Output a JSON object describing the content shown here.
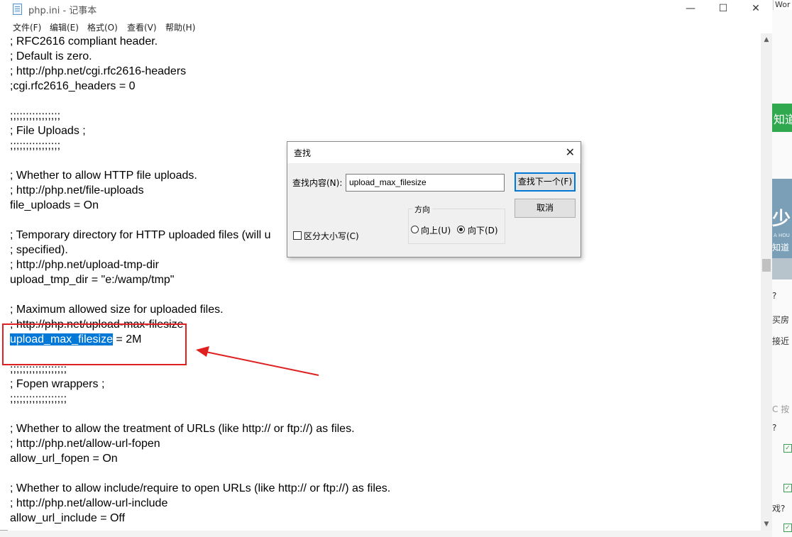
{
  "window": {
    "title": "php.ini - 记事本",
    "minimize": "—",
    "maximize": "☐",
    "close": "✕"
  },
  "menu": [
    "文件(F)",
    "编辑(E)",
    "格式(O)",
    "查看(V)",
    "帮助(H)"
  ],
  "editor_lines": [
    "; RFC2616 compliant header.",
    "; Default is zero.",
    "; http://php.net/cgi.rfc2616-headers",
    ";cgi.rfc2616_headers = 0",
    "",
    ";;;;;;;;;;;;;;;;",
    "; File Uploads ;",
    ";;;;;;;;;;;;;;;;",
    "",
    "; Whether to allow HTTP file uploads.",
    "; http://php.net/file-uploads",
    "file_uploads = On",
    "",
    "; Temporary directory for HTTP uploaded files (will u",
    "; specified).",
    "; http://php.net/upload-tmp-dir",
    "upload_tmp_dir = \"e:/wamp/tmp\"",
    "",
    "; Maximum allowed size for uploaded files.",
    "; http://php.net/upload-max-filesize",
    "",
    "",
    ";;;;;;;;;;;;;;;;;;",
    "; Fopen wrappers ;",
    ";;;;;;;;;;;;;;;;;;",
    "",
    "; Whether to allow the treatment of URLs (like http:// or ftp://) as files.",
    "; http://php.net/allow-url-fopen",
    "allow_url_fopen = On",
    "",
    "; Whether to allow include/require to open URLs (like http:// or ftp://) as files.",
    "; http://php.net/allow-url-include",
    "allow_url_include = Off"
  ],
  "selected_line": {
    "selection": "upload_max_filesize",
    "rest": " = 2M"
  },
  "find_dialog": {
    "title": "查找",
    "close": "✕",
    "label": "查找内容(N):",
    "value": "upload_max_filesize",
    "find_next": "查找下一个(F)",
    "cancel": "取消",
    "direction_title": "方向",
    "up": "向上(U)",
    "down": "向下(D)",
    "selected_direction": "down",
    "match_case": "区分大小写(C)",
    "match_case_checked": false
  },
  "background": {
    "top_right_text": "Wor",
    "green_banner": "知道",
    "photo_text_1": "少",
    "photo_text_2": "A HOU",
    "photo_text_3": "知道",
    "side_text_1": "买房",
    "side_text_2": "接近",
    "side_text_3": "戏?",
    "refresh_text": "C 按",
    "question": "?"
  },
  "annotation_color": "#e02020",
  "selection_color": "#0078d7"
}
